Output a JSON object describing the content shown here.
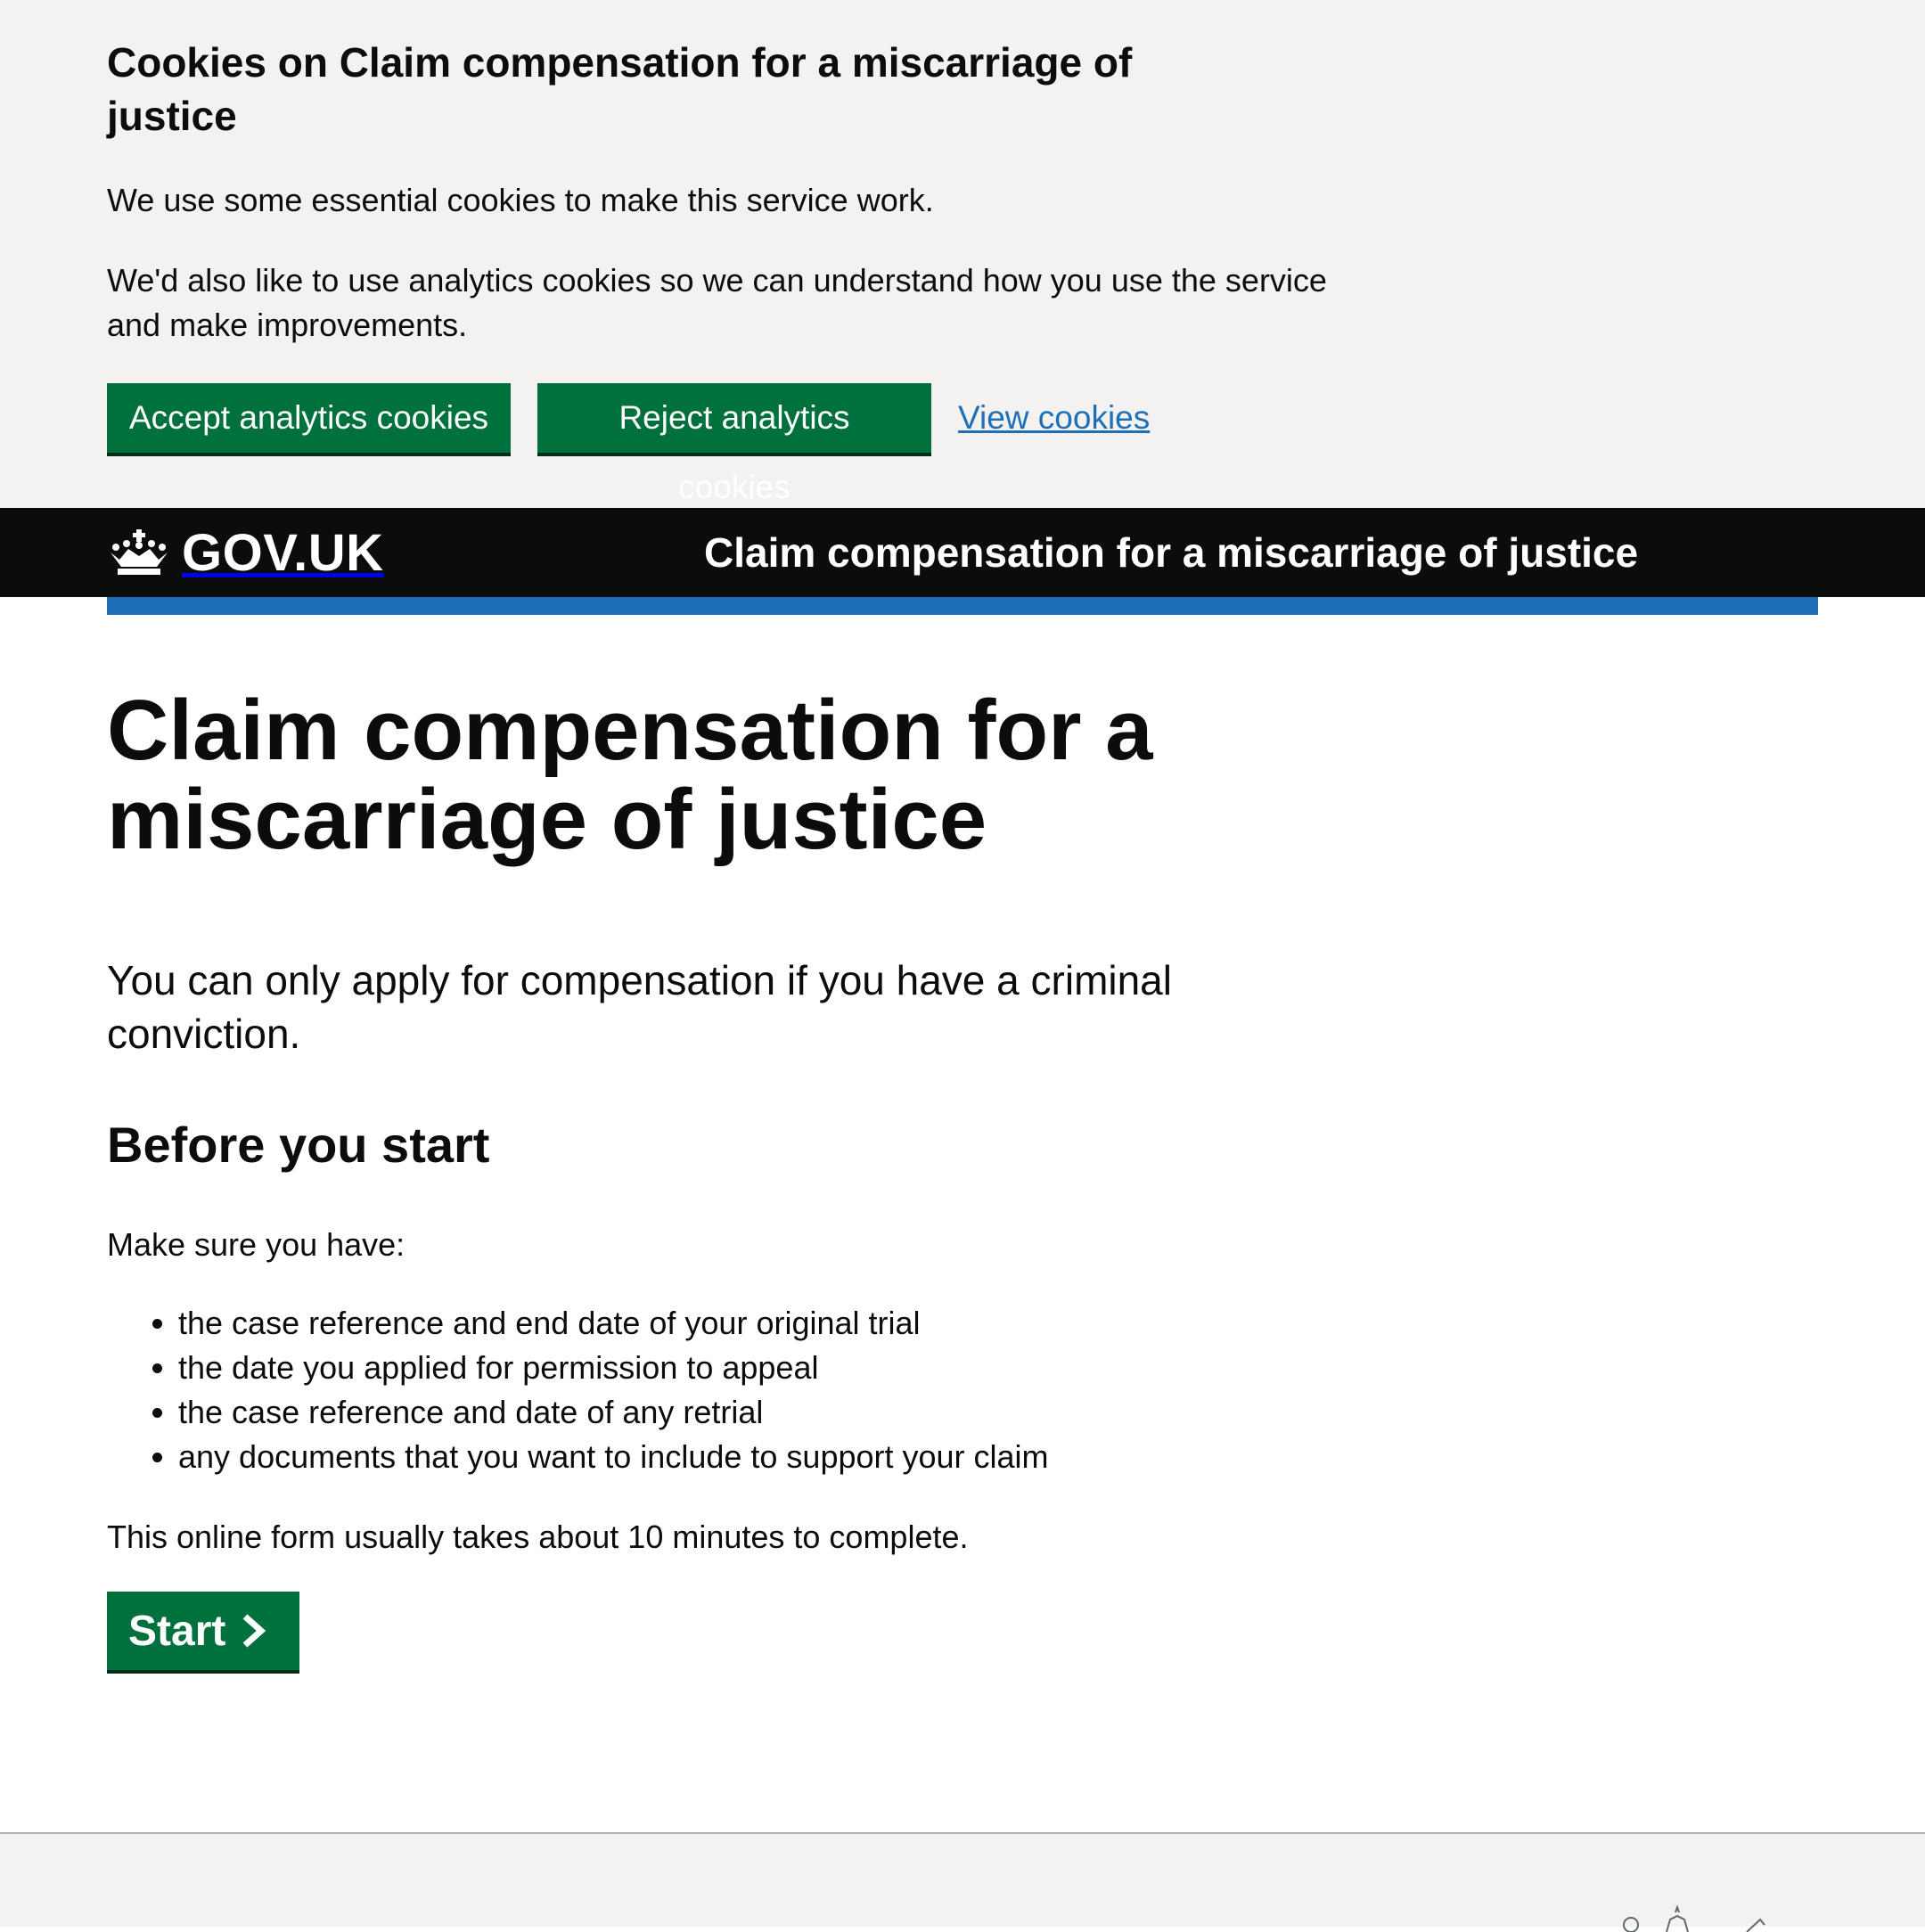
{
  "cookie_banner": {
    "title": "Cookies on Claim compensation for a miscarriage of justice",
    "paragraph_1": "We use some essential cookies to make this service work.",
    "paragraph_2": "We'd also like to use analytics cookies so we can understand how you use the service and make improvements.",
    "accept_label": "Accept analytics cookies",
    "reject_label": "Reject analytics cookies",
    "view_link": "View cookies"
  },
  "header": {
    "logo_text": "GOV.UK",
    "logo_icon": "crown-icon",
    "service_name": "Claim compensation for a miscarriage of justice"
  },
  "main": {
    "title": "Claim compensation for a miscarriage of justice",
    "lead": "You can only apply for compensation if you have a criminal conviction.",
    "before_heading": "Before you start",
    "make_sure": "Make sure you have:",
    "checklist": [
      "the case reference and end date of your original trial",
      "the date you applied for permission to appeal",
      "the case reference and date of any retrial",
      "any documents that you want to include to support your claim"
    ],
    "duration": "This online form usually takes about 10 minutes to complete.",
    "start_label": "Start",
    "start_icon": "chevron-right-icon"
  },
  "colors": {
    "banner_bg": "#f3f2f1",
    "header_bg": "#0b0c0c",
    "brand_blue": "#1d70b8",
    "button_green": "#00703c",
    "text": "#0b0c0c"
  }
}
